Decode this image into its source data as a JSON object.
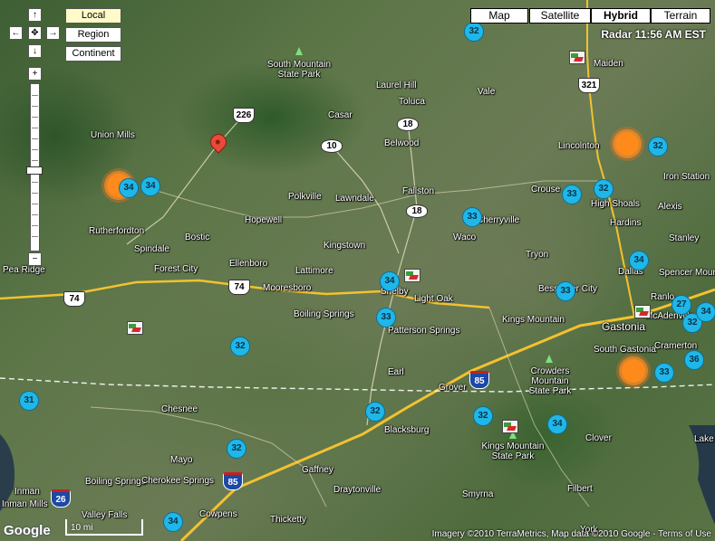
{
  "map_type_buttons": [
    {
      "label": "Map",
      "selected": false
    },
    {
      "label": "Satellite",
      "selected": false
    },
    {
      "label": "Hybrid",
      "selected": true
    },
    {
      "label": "Terrain",
      "selected": false
    }
  ],
  "scale_buttons": [
    {
      "label": "Local",
      "selected": true
    },
    {
      "label": "Region",
      "selected": false
    },
    {
      "label": "Continent",
      "selected": false
    }
  ],
  "nav": {
    "up": "↑",
    "down": "↓",
    "left": "←",
    "right": "→",
    "center": "✥",
    "zoom_in": "+",
    "zoom_out": "−"
  },
  "radar_timestamp": "Radar 11:56 AM EST",
  "attribution": "Imagery ©2010 TerraMetrics, Map data ©2010 Google - Terms of Use",
  "google_logo": "Google",
  "scale_label": "10 mi",
  "places": [
    {
      "label": "Union Mills",
      "park": false
    },
    {
      "label": "Rutherfordton",
      "park": false
    },
    {
      "label": "Spindale",
      "park": false
    },
    {
      "label": "Forest City",
      "park": false
    },
    {
      "label": "Bostic",
      "park": false
    },
    {
      "label": "Ellenboro",
      "park": false
    },
    {
      "label": "Pea Ridge",
      "park": false
    },
    {
      "label": "Hopewell",
      "park": false
    },
    {
      "label": "Polkville",
      "park": false
    },
    {
      "label": "Lawndale",
      "park": false
    },
    {
      "label": "Casar",
      "park": false
    },
    {
      "label": "Belwood",
      "park": false
    },
    {
      "label": "Toluca",
      "park": false
    },
    {
      "label": "Laurel Hill",
      "park": false
    },
    {
      "label": "Vale",
      "park": false
    },
    {
      "label": "Maiden",
      "park": false
    },
    {
      "label": "Lincolnton",
      "park": false
    },
    {
      "label": "Iron Station",
      "park": false
    },
    {
      "label": "Crouse",
      "park": false
    },
    {
      "label": "High Shoals",
      "park": false
    },
    {
      "label": "Hardins",
      "park": false
    },
    {
      "label": "Alexis",
      "park": false
    },
    {
      "label": "Stanley",
      "park": false
    },
    {
      "label": "Fallston",
      "park": false
    },
    {
      "label": "Cherryville",
      "park": false
    },
    {
      "label": "Waco",
      "park": false
    },
    {
      "label": "Kingstown",
      "park": false
    },
    {
      "label": "Lattimore",
      "park": false
    },
    {
      "label": "Mooresboro",
      "park": false
    },
    {
      "label": "Shelby",
      "park": false
    },
    {
      "label": "Light Oak",
      "park": false
    },
    {
      "label": "Boiling Springs",
      "park": false
    },
    {
      "label": "Patterson Springs",
      "park": false
    },
    {
      "label": "Earl",
      "park": false
    },
    {
      "label": "Grover",
      "park": false
    },
    {
      "label": "Kings Mountain",
      "park": false
    },
    {
      "label": "Bessemer City",
      "park": false
    },
    {
      "label": "Tryon",
      "park": false
    },
    {
      "label": "Dallas",
      "park": false
    },
    {
      "label": "Spencer Mountain",
      "park": false
    },
    {
      "label": "Ranlo",
      "park": false
    },
    {
      "label": "Gastonia",
      "park": false
    },
    {
      "label": "McAdenville",
      "park": false
    },
    {
      "label": "South Gastonia",
      "park": false
    },
    {
      "label": "Cramerton",
      "park": false
    },
    {
      "label": "Clover",
      "park": false
    },
    {
      "label": "Lake Wylie",
      "park": false
    },
    {
      "label": "Chesnee",
      "park": false
    },
    {
      "label": "Mayo",
      "park": false
    },
    {
      "label": "Gaffney",
      "park": false
    },
    {
      "label": "Blacksburg",
      "park": false
    },
    {
      "label": "Draytonville",
      "park": false
    },
    {
      "label": "Smyrna",
      "park": false
    },
    {
      "label": "Filbert",
      "park": false
    },
    {
      "label": "Boiling Springs",
      "park": false
    },
    {
      "label": "Cherokee Springs",
      "park": false
    },
    {
      "label": "Cowpens",
      "park": false
    },
    {
      "label": "Thicketty",
      "park": false
    },
    {
      "label": "Valley Falls",
      "park": false
    },
    {
      "label": "Inman",
      "park": false
    },
    {
      "label": "Inman Mills",
      "park": false
    },
    {
      "label": "York",
      "park": false
    },
    {
      "label": "South Mountain State Park",
      "park": true
    },
    {
      "label": "Crowders Mountain State Park",
      "park": true
    },
    {
      "label": "Kings Mountain State Park",
      "park": true
    }
  ],
  "route_shields": [
    {
      "label": "226",
      "kind": "us"
    },
    {
      "label": "18",
      "kind": "state"
    },
    {
      "label": "10",
      "kind": "state"
    },
    {
      "label": "18",
      "kind": "state"
    },
    {
      "label": "321",
      "kind": "us"
    },
    {
      "label": "74",
      "kind": "us"
    },
    {
      "label": "74",
      "kind": "us"
    },
    {
      "label": "85",
      "kind": "interstate"
    },
    {
      "label": "85",
      "kind": "interstate"
    },
    {
      "label": "26",
      "kind": "interstate"
    }
  ],
  "storm_markers": [
    {
      "label": "32"
    },
    {
      "label": "34"
    },
    {
      "label": "34"
    },
    {
      "label": "32"
    },
    {
      "label": "33"
    },
    {
      "label": "32"
    },
    {
      "label": "33"
    },
    {
      "label": "34"
    },
    {
      "label": "33"
    },
    {
      "label": "34"
    },
    {
      "label": "33"
    },
    {
      "label": "32"
    },
    {
      "label": "27"
    },
    {
      "label": "32"
    },
    {
      "label": "34"
    },
    {
      "label": "36"
    },
    {
      "label": "33"
    },
    {
      "label": "31"
    },
    {
      "label": "32"
    },
    {
      "label": "32"
    },
    {
      "label": "32"
    },
    {
      "label": "34"
    },
    {
      "label": "34"
    }
  ],
  "colors": {
    "storm_marker": "#1fb7e8",
    "sun_marker": "#ff8a1c",
    "pin": "#e84a3a",
    "interstate": "#1c48a6",
    "highway": "#f2c230"
  }
}
